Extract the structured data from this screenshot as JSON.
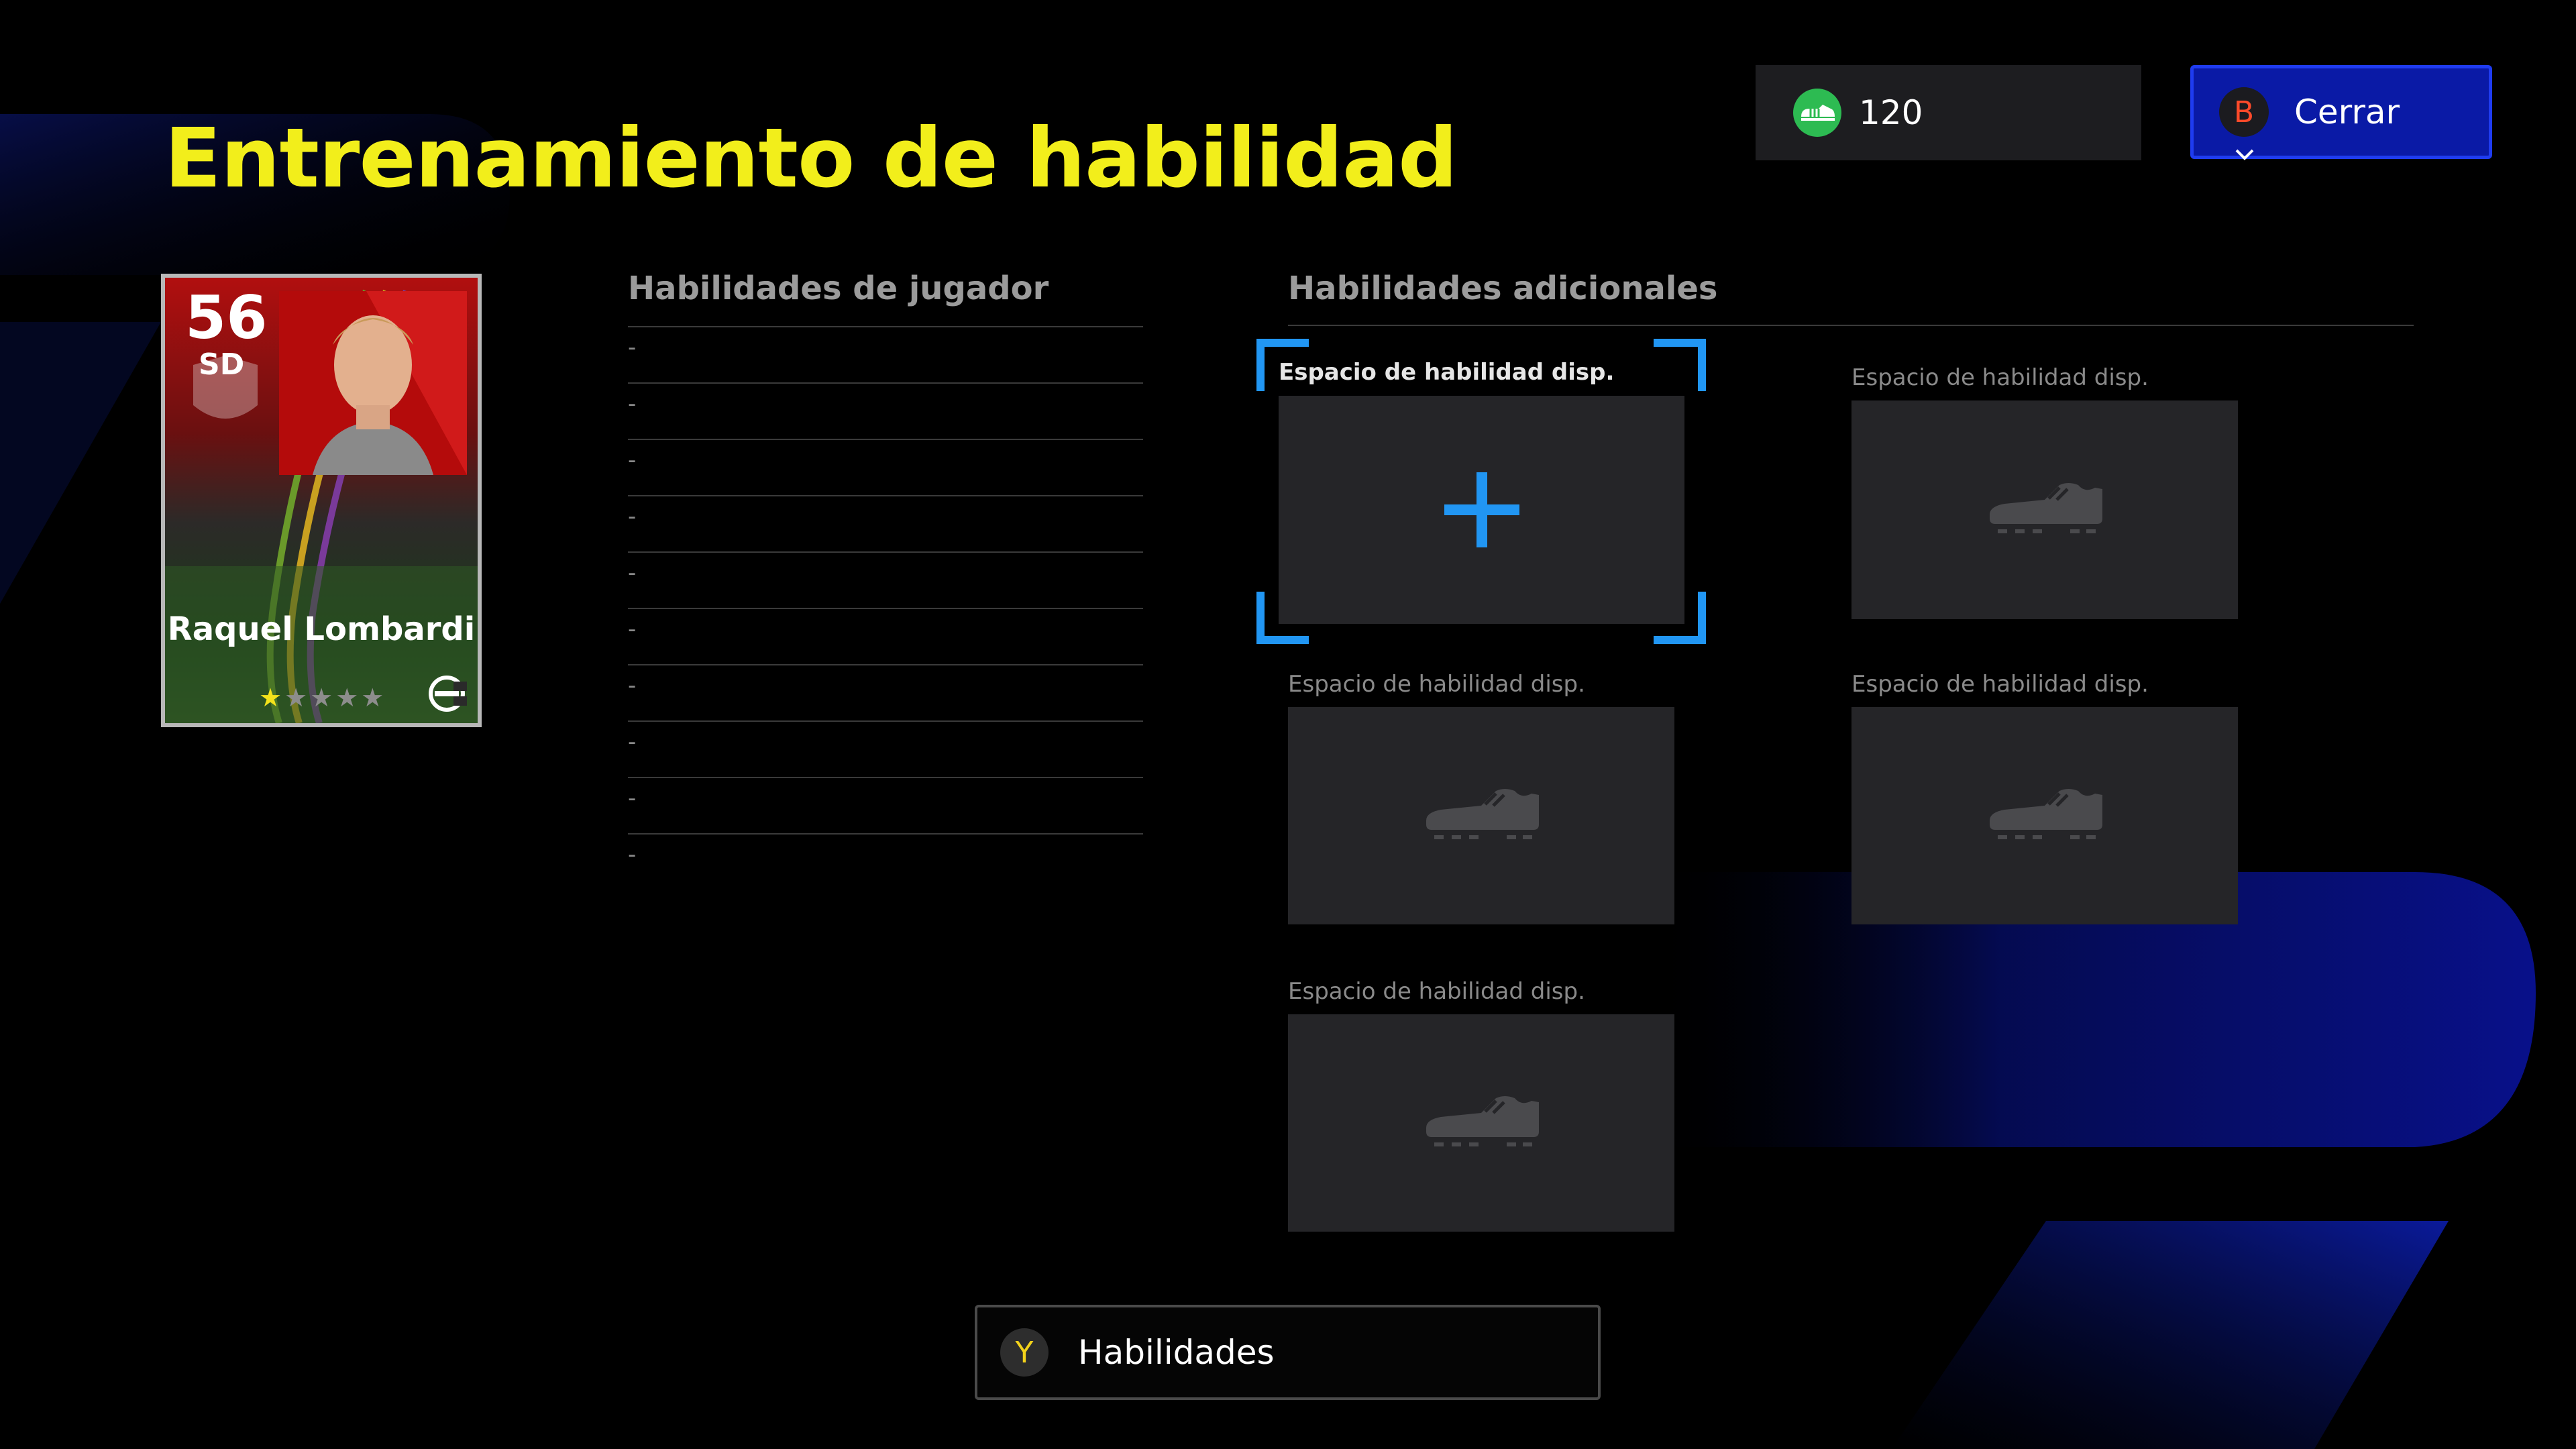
{
  "page": {
    "title": "Entrenamiento de habilidad"
  },
  "currency": {
    "icon": "skill-points-icon",
    "value": "120",
    "color": "#2dbb52"
  },
  "close_button": {
    "button_letter": "B",
    "label": "Cerrar",
    "color": "#0a1aa6"
  },
  "player_card": {
    "rating": "56",
    "position": "SD",
    "name": "Raquel Lombardi",
    "stars_filled": 1,
    "stars_total": 5,
    "stars_filled_text": "★",
    "stars_empty_text": "★★★★"
  },
  "player_skills": {
    "header": "Habilidades de jugador",
    "items": [
      "-",
      "-",
      "-",
      "-",
      "-",
      "-",
      "-",
      "-",
      "-",
      "-"
    ]
  },
  "additional_skills": {
    "header": "Habilidades adicionales",
    "slots": [
      {
        "label": "Espacio de habilidad disp.",
        "state": "add",
        "selected": true
      },
      {
        "label": "Espacio de habilidad disp.",
        "state": "empty",
        "selected": false
      },
      {
        "label": "Espacio de habilidad disp.",
        "state": "empty",
        "selected": false
      },
      {
        "label": "Espacio de habilidad disp.",
        "state": "empty",
        "selected": false
      },
      {
        "label": "Espacio de habilidad disp.",
        "state": "empty",
        "selected": false
      }
    ]
  },
  "footer": {
    "button_letter": "Y",
    "label": "Habilidades"
  },
  "colors": {
    "title": "#f2ee1b",
    "accent_blue": "#2196f3",
    "background": "#000000"
  }
}
